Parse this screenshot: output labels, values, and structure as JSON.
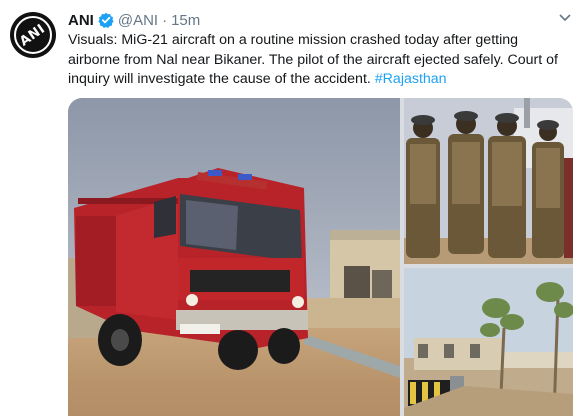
{
  "tweet": {
    "avatar_text": "ANI",
    "display_name": "ANI",
    "handle": "@ANI",
    "separator": "·",
    "time": "15m",
    "body_text": "Visuals: MiG-21 aircraft on a routine mission crashed today after getting airborne from Nal near Bikaner. The pilot of the aircraft ejected safely. Court of inquiry will investigate the cause of the accident.",
    "hashtag": "#Rajasthan"
  },
  "icons": {
    "verified": "verified-badge-icon",
    "caret": "chevron-down-icon"
  },
  "colors": {
    "link": "#1da1f2",
    "secondary_text": "#657786",
    "primary_text": "#14171a",
    "fire_truck_red": "#c0262a"
  }
}
